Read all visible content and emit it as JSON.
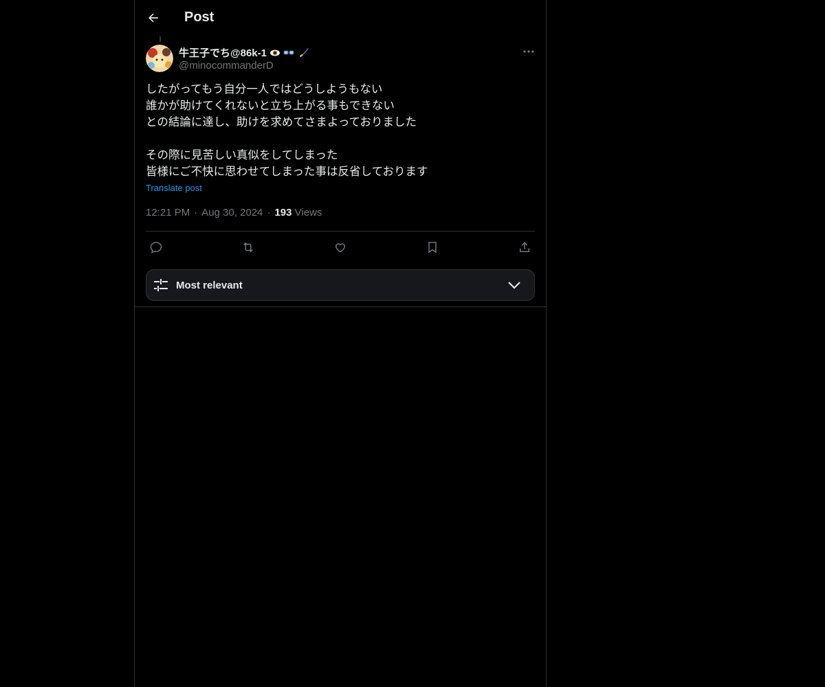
{
  "header": {
    "title": "Post",
    "back_icon": "arrow-left-icon"
  },
  "post": {
    "author": {
      "display_name": "牛王子でち@86k-1",
      "handle": "@minocommanderD",
      "name_emojis": [
        "eye-icon",
        "glasses-icon",
        "paintbrush-icon"
      ]
    },
    "text": "したがってもう自分一人ではどうしようもない\n誰かが助けてくれないと立ち上がる事もできない\nとの結論に達し、助けを求めてさまよっておりました\n\nその際に見苦しい真似をしてしまった\n皆様にご不快に思わせてしまった事は反省しております",
    "translate_label": "Translate post",
    "time": "12:21 PM",
    "separator": "·",
    "date": "Aug 30, 2024",
    "views_count": "193",
    "views_label": "Views"
  },
  "actions": [
    "reply-icon",
    "repost-icon",
    "like-icon",
    "bookmark-icon",
    "share-icon"
  ],
  "sort": {
    "label": "Most relevant",
    "icon": "sliders-icon",
    "chevron": "chevron-down-icon"
  },
  "colors": {
    "background": "#000000",
    "text": "#e7e9ea",
    "muted": "#71767b",
    "accent": "#1d9bf0",
    "border": "#2f3336"
  }
}
